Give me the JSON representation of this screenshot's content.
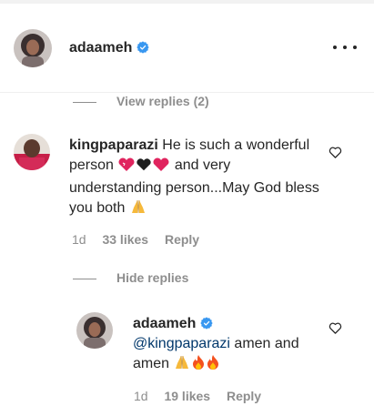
{
  "post_header": {
    "username": "adaameh",
    "verified": true,
    "more_icon": "more-horizontal-icon"
  },
  "view_replies": {
    "label": "View replies (2)"
  },
  "comments": [
    {
      "username": "kingpaparazi",
      "text_part1": "He is such a wonderful person",
      "text_part2": "and very understanding person...May God bless you both",
      "emojis_mid": [
        "heart-hearts-icon",
        "black-heart-icon",
        "red-heart-icon"
      ],
      "emoji_end": "folded-hands-icon",
      "time": "1d",
      "likes": "33 likes",
      "reply_label": "Reply"
    }
  ],
  "hide_replies": {
    "label": "Hide replies"
  },
  "reply": {
    "username": "adaameh",
    "verified": true,
    "mention": "@kingpaparazi",
    "text": "amen and amen",
    "emojis": [
      "folded-hands-icon",
      "fire-icon",
      "fire-icon"
    ],
    "time": "1d",
    "likes": "19 likes",
    "reply_label": "Reply"
  },
  "colors": {
    "primary_text": "#262626",
    "secondary_text": "#8e8e8e",
    "mention": "#00376b",
    "verified_blue": "#3897f0"
  }
}
